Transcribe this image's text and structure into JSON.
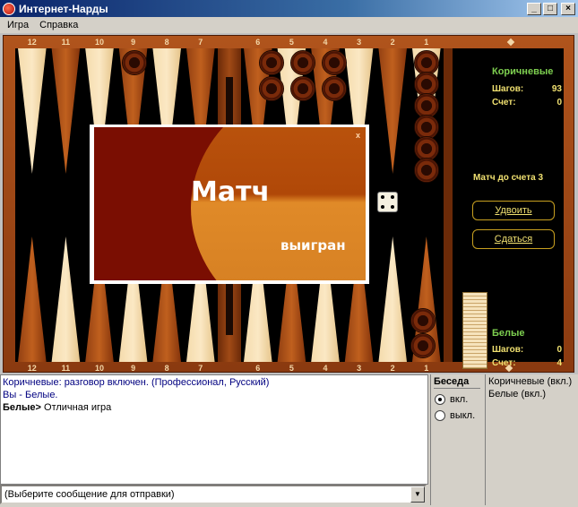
{
  "window": {
    "title": "Интернет-Нарды",
    "min_label": "_",
    "max_label": "□",
    "close_label": "×"
  },
  "menu": {
    "items": [
      "Игра",
      "Справка"
    ]
  },
  "board": {
    "top_left_points": [
      "12",
      "11",
      "10",
      "9",
      "8",
      "7"
    ],
    "top_right_points": [
      "6",
      "5",
      "4",
      "3",
      "2",
      "1"
    ],
    "bottom_left_points": [
      "12",
      "11",
      "10",
      "9",
      "8",
      "7"
    ],
    "bottom_right_points": [
      "6",
      "5",
      "4",
      "3",
      "2",
      "1"
    ],
    "colors": {
      "light_point": "#f3d9a8",
      "dark_point": "#a04a16",
      "frame": "#a04a16",
      "checker": "#6a2408"
    },
    "die_value": 4
  },
  "panel": {
    "brown": {
      "title": "Коричневые",
      "steps_label": "Шагов:",
      "steps_value": "93",
      "score_label": "Счет:",
      "score_value": "0"
    },
    "match_to": "Матч до счета 3",
    "double_button": "Удвоить",
    "resign_button": "Сдаться",
    "white": {
      "title": "Белые",
      "steps_label": "Шагов:",
      "steps_value": "0",
      "score_label": "Счет:",
      "score_value": "4"
    }
  },
  "dialog": {
    "close": "x",
    "big_text": "Матч",
    "small_text": "выигран"
  },
  "chat": {
    "lines": [
      {
        "text": "Коричневые: разговор включен.  (Профессионал, Русский)"
      },
      {
        "text": "Вы - Белые."
      },
      {
        "sender": "Белые>",
        "text": " Отличная игра"
      }
    ],
    "select_placeholder": "(Выберите сообщение для отправки)",
    "select_arrow": "▼"
  },
  "talk": {
    "title": "Беседа",
    "on_label": "вкл.",
    "off_label": "выкл.",
    "selected": "on"
  },
  "users": [
    "Коричневые (вкл.)",
    "Белые (вкл.)"
  ]
}
